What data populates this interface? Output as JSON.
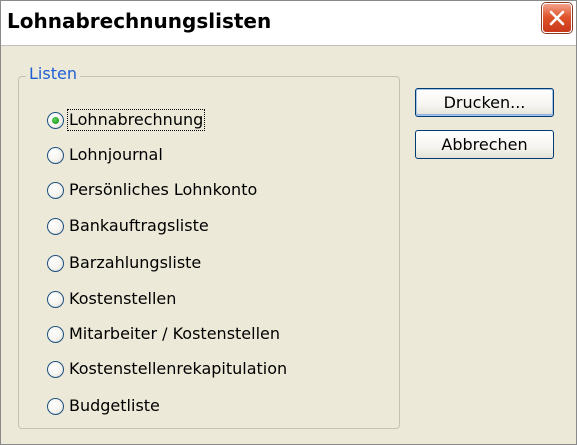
{
  "window": {
    "title": "Lohnabrechnungslisten",
    "close_icon": "close-icon"
  },
  "group": {
    "legend": "Listen",
    "selected_index": 0,
    "options": [
      {
        "label": "Lohnabrechnung"
      },
      {
        "label": "Lohnjournal"
      },
      {
        "label": "Persönliches Lohnkonto"
      },
      {
        "label": "Bankauftragsliste"
      },
      {
        "label": "Barzahlungsliste"
      },
      {
        "label": "Kostenstellen"
      },
      {
        "label": "Mitarbeiter / Kostenstellen"
      },
      {
        "label": "Kostenstellenrekapitulation"
      },
      {
        "label": "Budgetliste"
      }
    ]
  },
  "buttons": {
    "print_label": "Drucken...",
    "cancel_label": "Abbrechen"
  },
  "colors": {
    "dialog_bg": "#ece9d8",
    "group_legend": "#1e5fd6",
    "close_button": "#e0552c",
    "radio_dot": "#21a121"
  }
}
